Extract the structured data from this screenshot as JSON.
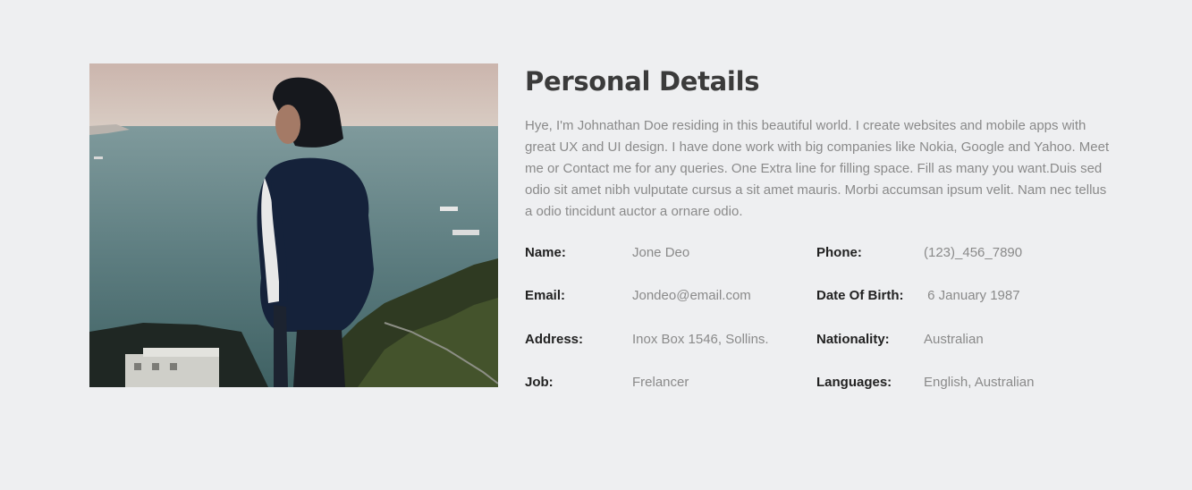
{
  "section": {
    "title": "Personal Details",
    "bio": "Hye, I'm Johnathan Doe residing in this beautiful world. I create websites and mobile apps with great UX and UI design. I have done work with big companies like Nokia, Google and Yahoo. Meet me or Contact me for any queries. One Extra line for filling space. Fill as many you want.Duis sed odio sit amet nibh vulputate cursus a sit amet mauris. Morbi accumsan ipsum velit. Nam nec tellus a odio tincidunt auctor a ornare odio."
  },
  "details": [
    {
      "left_label": "Name:",
      "left_value": "Jone Deo",
      "right_label": "Phone:",
      "right_value": "(123)_456_7890"
    },
    {
      "left_label": "Email:",
      "left_value": "Jondeo@email.com",
      "right_label": "Date Of Birth:",
      "right_value": " 6 January 1987"
    },
    {
      "left_label": "Address:",
      "left_value": "Inox Box 1546, Sollins.",
      "right_label": "Nationality:",
      "right_value": "Australian"
    },
    {
      "left_label": "Job:",
      "left_value": "Frelancer",
      "right_label": "Languages:",
      "right_value": "English, Australian"
    }
  ],
  "colors": {
    "background": "#eeeff1",
    "title": "#3b3b3b",
    "label": "#222222",
    "value": "#8a8a8a"
  }
}
